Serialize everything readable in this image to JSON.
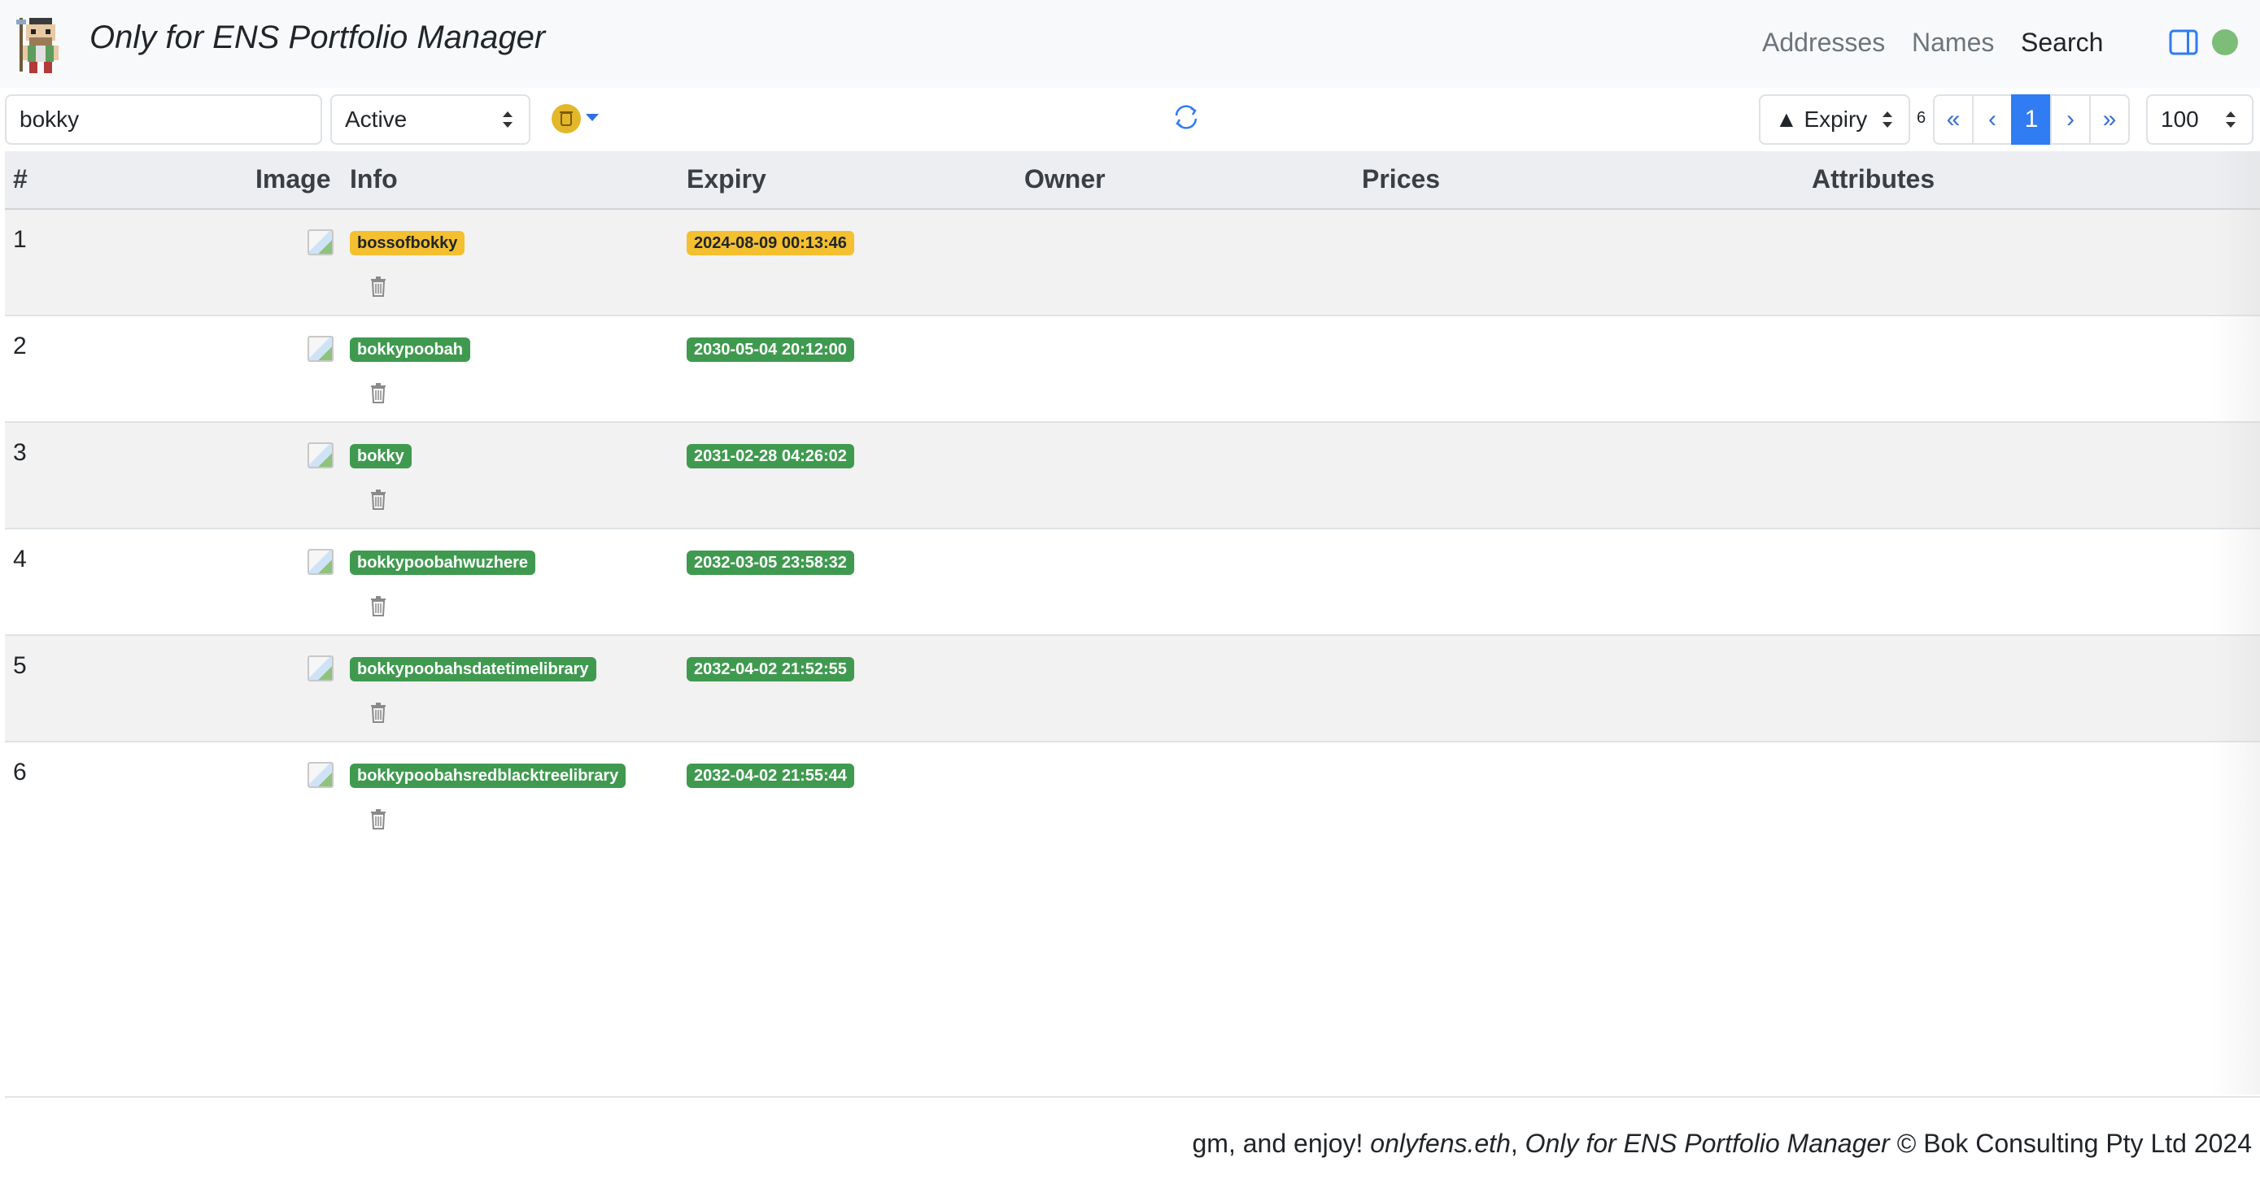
{
  "header": {
    "title": "Only for ENS Portfolio Manager",
    "nav": [
      {
        "label": "Addresses",
        "active": false
      },
      {
        "label": "Names",
        "active": false
      },
      {
        "label": "Search",
        "active": true
      }
    ]
  },
  "toolbar": {
    "search_value": "bokky",
    "status_select": "Active",
    "sort_select": "▲ Expiry",
    "result_count": "6",
    "pagination": [
      "«",
      "‹",
      "1",
      "›",
      "»"
    ],
    "current_page": "1",
    "page_size": "100"
  },
  "table": {
    "columns": [
      "#",
      "Image",
      "Info",
      "Expiry",
      "Owner",
      "Prices",
      "Attributes"
    ],
    "rows": [
      {
        "num": "1",
        "name": "bossofbokky",
        "expiry": "2024-08-09 00:13:46",
        "status": "warning"
      },
      {
        "num": "2",
        "name": "bokkypoobah",
        "expiry": "2030-05-04 20:12:00",
        "status": "ok"
      },
      {
        "num": "3",
        "name": "bokky",
        "expiry": "2031-02-28 04:26:02",
        "status": "ok"
      },
      {
        "num": "4",
        "name": "bokkypoobahwuzhere",
        "expiry": "2032-03-05 23:58:32",
        "status": "ok"
      },
      {
        "num": "5",
        "name": "bokkypoobahsdatetimelibrary",
        "expiry": "2032-04-02 21:52:55",
        "status": "ok"
      },
      {
        "num": "6",
        "name": "bokkypoobahsredblacktreelibrary",
        "expiry": "2032-04-02 21:55:44",
        "status": "ok"
      }
    ]
  },
  "footer": {
    "prefix": "gm, and enjoy! ",
    "domain": "onlyfens.eth",
    "sep": ", ",
    "app": "Only for ENS Portfolio Manager",
    "copyright": " © Bok Consulting Pty Ltd 2024"
  },
  "colors": {
    "accent": "#2f7cf3",
    "badge_ok": "#3f9a4f",
    "badge_warn": "#f4c030",
    "status_dot": "#7cbd77"
  },
  "icons": [
    "app-logo",
    "sidebar-toggle-icon",
    "status-indicator",
    "filter-icon",
    "refresh-icon",
    "trash-icon",
    "image-thumbnail"
  ]
}
